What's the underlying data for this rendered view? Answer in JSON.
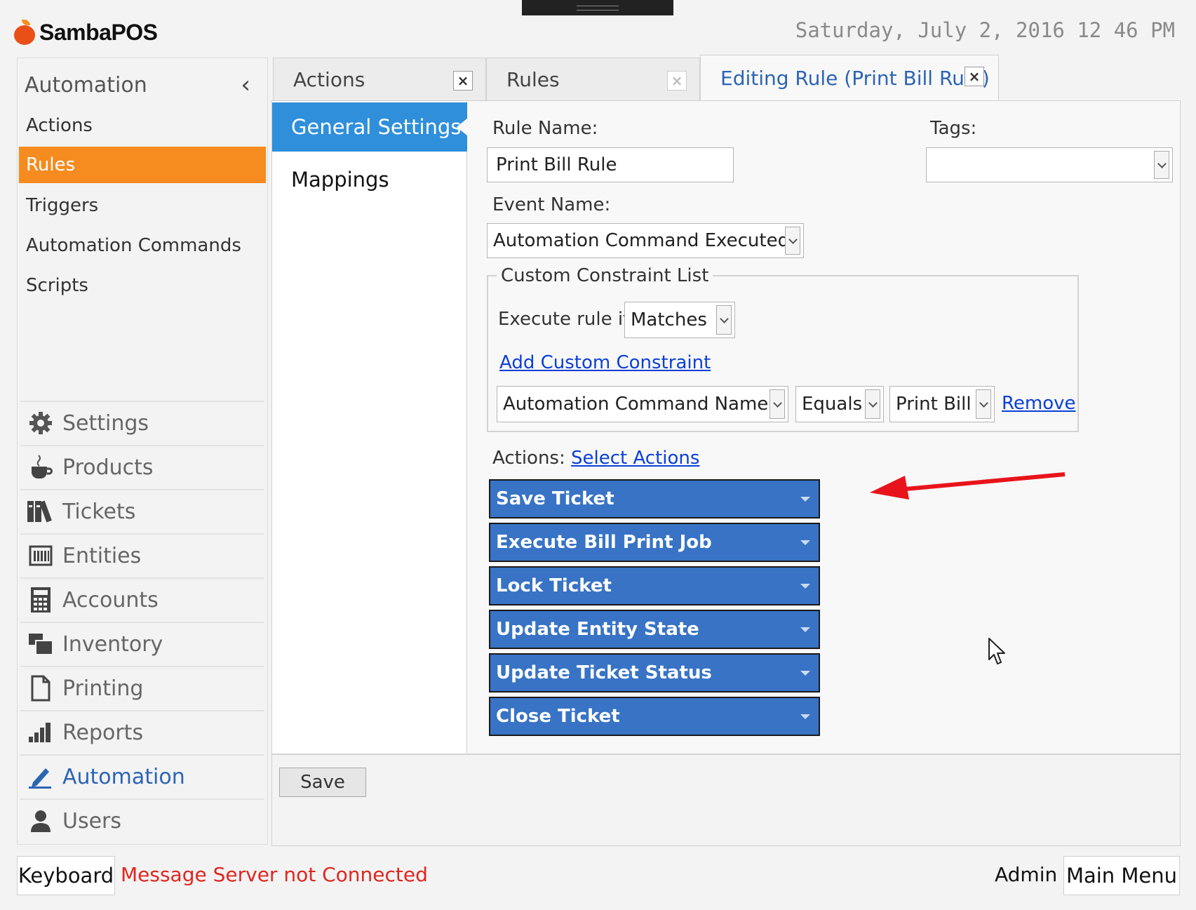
{
  "app": {
    "name": "SambaPOS",
    "datetime": "Saturday, July 2, 2016 12 46 PM"
  },
  "sidebar": {
    "header": "Automation",
    "collapse_glyph": "‹",
    "sub_items": [
      {
        "label": "Actions"
      },
      {
        "label": "Rules",
        "active": true
      },
      {
        "label": "Triggers"
      },
      {
        "label": "Automation Commands"
      },
      {
        "label": "Scripts"
      }
    ],
    "nav": [
      {
        "label": "Settings",
        "icon": "gear-icon"
      },
      {
        "label": "Products",
        "icon": "coffee-cup-icon"
      },
      {
        "label": "Tickets",
        "icon": "books-icon"
      },
      {
        "label": "Entities",
        "icon": "entities-grid-icon"
      },
      {
        "label": "Accounts",
        "icon": "calculator-icon"
      },
      {
        "label": "Inventory",
        "icon": "inventory-icon"
      },
      {
        "label": "Printing",
        "icon": "document-icon"
      },
      {
        "label": "Reports",
        "icon": "bar-chart-icon"
      },
      {
        "label": "Automation",
        "icon": "pen-icon",
        "active": true
      },
      {
        "label": "Users",
        "icon": "user-icon"
      }
    ]
  },
  "tabs": [
    {
      "label": "Actions",
      "close": "×"
    },
    {
      "label": "Rules",
      "close": "×"
    },
    {
      "label": "Editing Rule (Print Bill Rule)",
      "close": "×",
      "active": true
    }
  ],
  "settings_nav": {
    "general": "General Settings",
    "mappings": "Mappings"
  },
  "form": {
    "rule_name_label": "Rule Name:",
    "rule_name_value": "Print Bill Rule",
    "tags_label": "Tags:",
    "tags_value": "",
    "event_name_label": "Event Name:",
    "event_name_value": "Automation Command Executed",
    "constraint_list_label": "Custom Constraint List",
    "execute_rule_if_label": "Execute rule if",
    "execute_rule_if_value": "Matches",
    "add_constraint_link": "Add Custom Constraint",
    "constraint": {
      "field": "Automation Command Name",
      "operator": "Equals",
      "value": "Print Bill",
      "remove": "Remove"
    },
    "actions_label": "Actions:",
    "select_actions_link": "Select Actions",
    "actions": [
      "Save Ticket",
      "Execute Bill Print Job",
      "Lock Ticket",
      "Update Entity State",
      "Update Ticket Status",
      "Close Ticket"
    ],
    "save_label": "Save"
  },
  "footer": {
    "keyboard": "Keyboard",
    "status": "Message Server not Connected",
    "user": "Admin",
    "main_menu": "Main Menu"
  },
  "colors": {
    "active_orange": "#f68b1f",
    "accent_blue": "#2f8fdb",
    "action_blue": "#3873c5",
    "status_red": "#e0261f",
    "link_blue": "#0b3fd8"
  }
}
